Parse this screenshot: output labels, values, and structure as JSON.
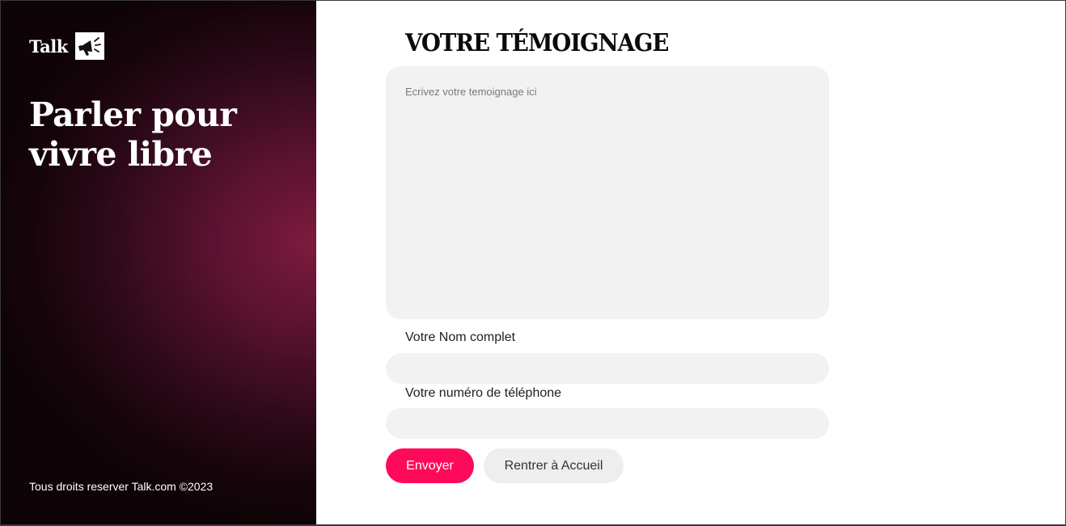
{
  "sidebar": {
    "brand": "Talk",
    "brand_icon": "megaphone-icon",
    "tagline": "Parler pour vivre libre",
    "copyright": "Tous droits reserver Talk.com ©2023",
    "gradient_accent": "#7d1b3d"
  },
  "form": {
    "title": "VOTRE TÉMOIGNAGE",
    "testimony_placeholder": "Ecrivez votre temoignage ici",
    "testimony_value": "",
    "name_label": "Votre Nom complet",
    "name_value": "",
    "phone_label": "Votre numéro de téléphone",
    "phone_value": "",
    "submit_label": "Envoyer",
    "back_label": "Rentrer à Accueil",
    "submit_color": "#ff0a5a",
    "field_bg": "#f2f2f2"
  }
}
